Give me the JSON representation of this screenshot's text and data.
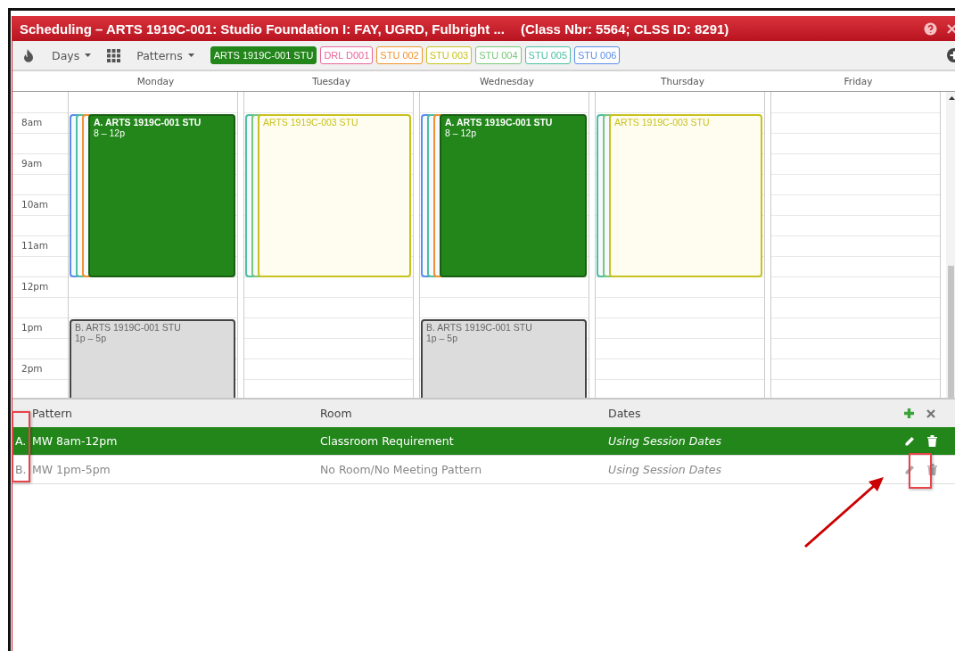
{
  "window": {
    "title": "Scheduling – ARTS 1919C-001: Studio Foundation I: FAY, UGRD, Fulbright ...",
    "subtitle": "(Class Nbr: 5564; CLSS ID: 8291)"
  },
  "toolbar": {
    "days_menu": "Days",
    "patterns_menu": "Patterns"
  },
  "filters": [
    {
      "label": "ARTS 1919C-001 STU",
      "color": "#22861a",
      "selected": true
    },
    {
      "label": "DRL D001",
      "color": "#e8679a",
      "selected": false
    },
    {
      "label": "STU 002",
      "color": "#f0932e",
      "selected": false
    },
    {
      "label": "STU 003",
      "color": "#c8c21e",
      "selected": false
    },
    {
      "label": "STU 004",
      "color": "#7ac77a",
      "selected": false
    },
    {
      "label": "STU 005",
      "color": "#4cc0a0",
      "selected": false
    },
    {
      "label": "STU 006",
      "color": "#5b8de8",
      "selected": false
    }
  ],
  "times": [
    "8am",
    "9am",
    "10am",
    "11am",
    "12pm",
    "1pm",
    "2pm"
  ],
  "days": [
    {
      "name": "Monday",
      "morning_events": [
        {
          "kind": "stacked",
          "color": "#5b8de8"
        },
        {
          "kind": "stacked",
          "color": "#4cc0a0"
        },
        {
          "kind": "stacked",
          "color": "#f0932e"
        },
        {
          "kind": "selected",
          "label": "A. ARTS 1919C-001 STU",
          "time": "8 – 12p"
        }
      ],
      "afternoon_events": [
        {
          "kind": "pattern",
          "label": "B. ARTS 1919C-001 STU",
          "time": "1p – 5p"
        }
      ]
    },
    {
      "name": "Tuesday",
      "morning_events": [
        {
          "kind": "stacked",
          "color": "#4cc0a0"
        },
        {
          "kind": "stacked",
          "color": "#7ac77a"
        },
        {
          "kind": "option",
          "label": "ARTS 1919C-003 STU",
          "color": "#c8c21e"
        }
      ]
    },
    {
      "name": "Wednesday",
      "morning_events": [
        {
          "kind": "stacked",
          "color": "#5b8de8"
        },
        {
          "kind": "stacked",
          "color": "#4cc0a0"
        },
        {
          "kind": "stacked",
          "color": "#f0932e"
        },
        {
          "kind": "selected",
          "label": "A. ARTS 1919C-001 STU",
          "time": "8 – 12p"
        }
      ],
      "afternoon_events": [
        {
          "kind": "pattern",
          "label": "B. ARTS 1919C-001 STU",
          "time": "1p – 5p"
        }
      ]
    },
    {
      "name": "Thursday",
      "morning_events": [
        {
          "kind": "stacked",
          "color": "#4cc0a0"
        },
        {
          "kind": "stacked",
          "color": "#7ac77a"
        },
        {
          "kind": "option",
          "label": "ARTS 1919C-003 STU",
          "color": "#c8c21e"
        }
      ]
    },
    {
      "name": "Friday"
    }
  ],
  "patterns_table": {
    "columns": [
      "Pattern",
      "Room",
      "Dates"
    ],
    "rows": [
      {
        "letter": "A.",
        "pattern": "MW 8am-12pm",
        "room": "Classroom Requirement",
        "dates": "Using Session Dates",
        "selected": true
      },
      {
        "letter": "B.",
        "pattern": "MW 1pm-5pm",
        "room": "No Room/No Meeting Pattern",
        "dates": "Using Session Dates",
        "selected": false
      }
    ]
  }
}
